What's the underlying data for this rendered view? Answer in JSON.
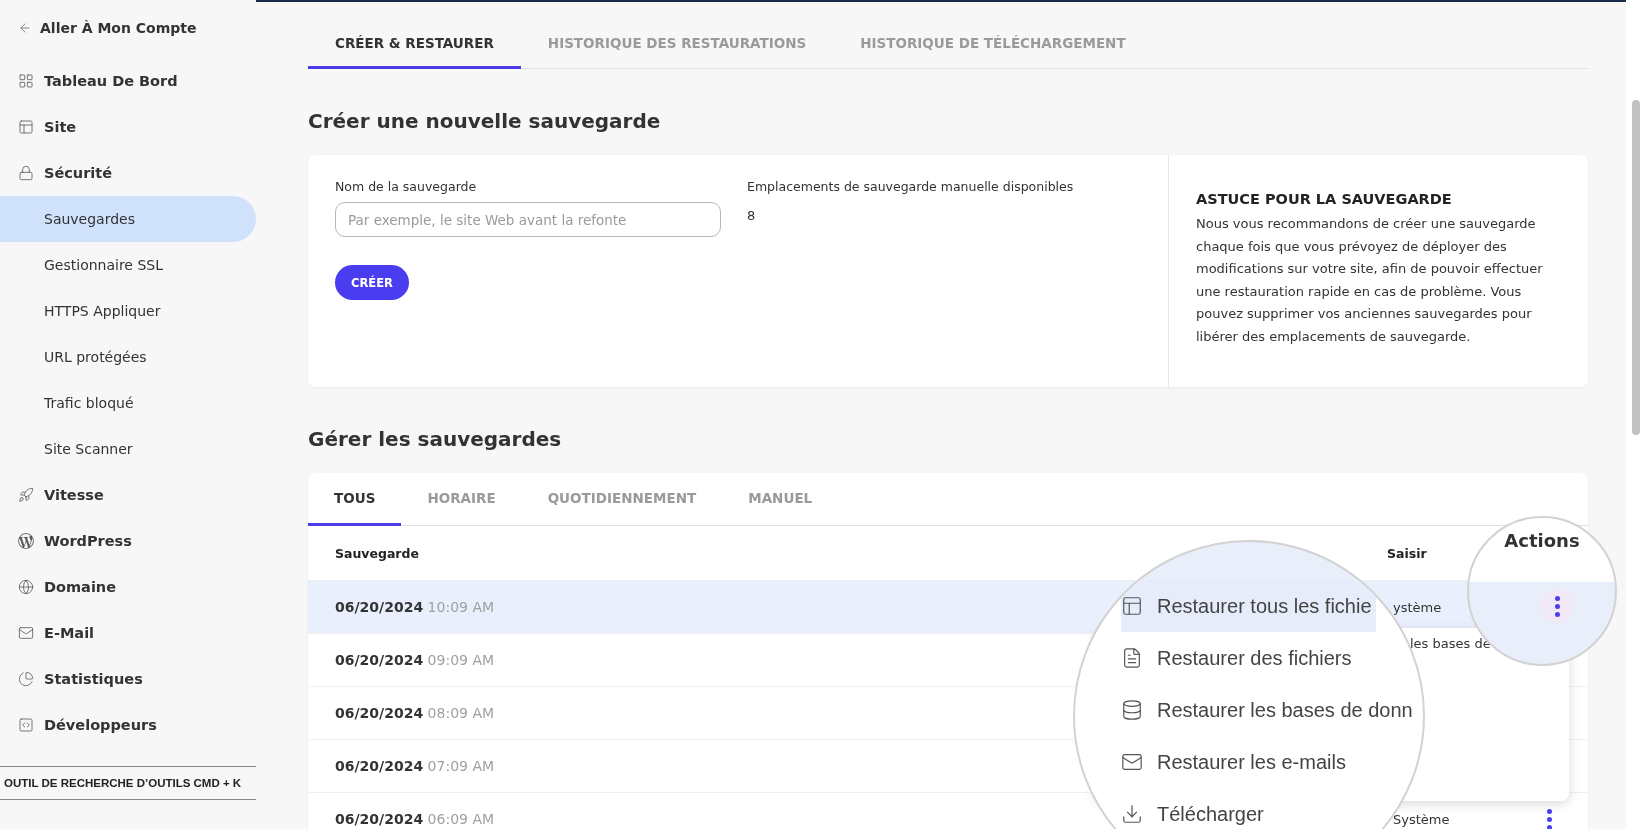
{
  "sidebar": {
    "back_link": "Aller À Mon Compte",
    "items": [
      {
        "label": "Tableau De Bord",
        "selected": false
      },
      {
        "label": "Site",
        "selected": false
      },
      {
        "label": "Sécurité",
        "selected": false,
        "children": [
          {
            "label": "Sauvegardes",
            "selected": true
          },
          {
            "label": "Gestionnaire SSL",
            "selected": false
          },
          {
            "label": "HTTPS Appliquer",
            "selected": false
          },
          {
            "label": "URL protégées",
            "selected": false
          },
          {
            "label": "Trafic bloqué",
            "selected": false
          },
          {
            "label": "Site Scanner",
            "selected": false
          }
        ]
      },
      {
        "label": "Vitesse",
        "selected": false
      },
      {
        "label": "WordPress",
        "selected": false
      },
      {
        "label": "Domaine",
        "selected": false
      },
      {
        "label": "E-Mail",
        "selected": false
      },
      {
        "label": "Statistiques",
        "selected": false
      },
      {
        "label": "Développeurs",
        "selected": false
      }
    ],
    "search_tool": "OUTIL DE RECHERCHE D’OUTILS CMD + K"
  },
  "top_tabs": [
    {
      "label": "CRÉER & RESTAURER",
      "selected": true
    },
    {
      "label": "HISTORIQUE DES RESTAURATIONS",
      "selected": false
    },
    {
      "label": "HISTORIQUE DE TÉLÉCHARGEMENT",
      "selected": false
    }
  ],
  "create": {
    "heading": "Créer une nouvelle sauvegarde",
    "name_field": {
      "label": "Nom de la sauvegarde",
      "placeholder": "Par exemple, le site Web avant la refonte"
    },
    "slots": {
      "label": "Emplacements de sauvegarde manuelle disponibles",
      "value": "8"
    },
    "button": "CRÉER",
    "tip": {
      "title": "ASTUCE POUR LA SAUVEGARDE",
      "text": "Nous vous recommandons de créer une sauvegarde chaque fois que vous prévoyez de déployer des modifications sur votre site, afin de pouvoir effectuer une restauration rapide en cas de problème. Vous pouvez supprimer vos anciennes sauvegardes pour libérer des emplacements de sauvegarde."
    }
  },
  "manage": {
    "heading": "Gérer les sauvegardes",
    "tabs": [
      {
        "label": "TOUS",
        "selected": true
      },
      {
        "label": "HORAIRE",
        "selected": false
      },
      {
        "label": "QUOTIDIENNEMENT",
        "selected": false
      },
      {
        "label": "MANUEL",
        "selected": false
      }
    ],
    "columns": [
      "Sauvegarde",
      "Saisir"
    ],
    "rows": [
      {
        "date": "06/20/2024",
        "time": "10:09 AM",
        "type": "ystème",
        "selected": true
      },
      {
        "date": "06/20/2024",
        "time": "09:09 AM",
        "selected": false
      },
      {
        "date": "06/20/2024",
        "time": "08:09 AM",
        "selected": false
      },
      {
        "date": "06/20/2024",
        "time": "07:09 AM",
        "selected": false
      },
      {
        "date": "06/20/2024",
        "time": "06:09 AM",
        "type": "Système",
        "selected": false,
        "actions": true
      }
    ]
  },
  "actions_lens": {
    "header": "Actions"
  },
  "menu": {
    "partial_item": "les bases de"
  },
  "menu_lens": {
    "items": [
      {
        "label": "Restaurer tous les fichie",
        "selected": true
      },
      {
        "label": "Restaurer des fichiers",
        "selected": false
      },
      {
        "label": "Restaurer les bases de donn",
        "selected": false
      },
      {
        "label": "Restaurer les e-mails",
        "selected": false
      },
      {
        "label": "Télécharger",
        "selected": false
      }
    ]
  }
}
